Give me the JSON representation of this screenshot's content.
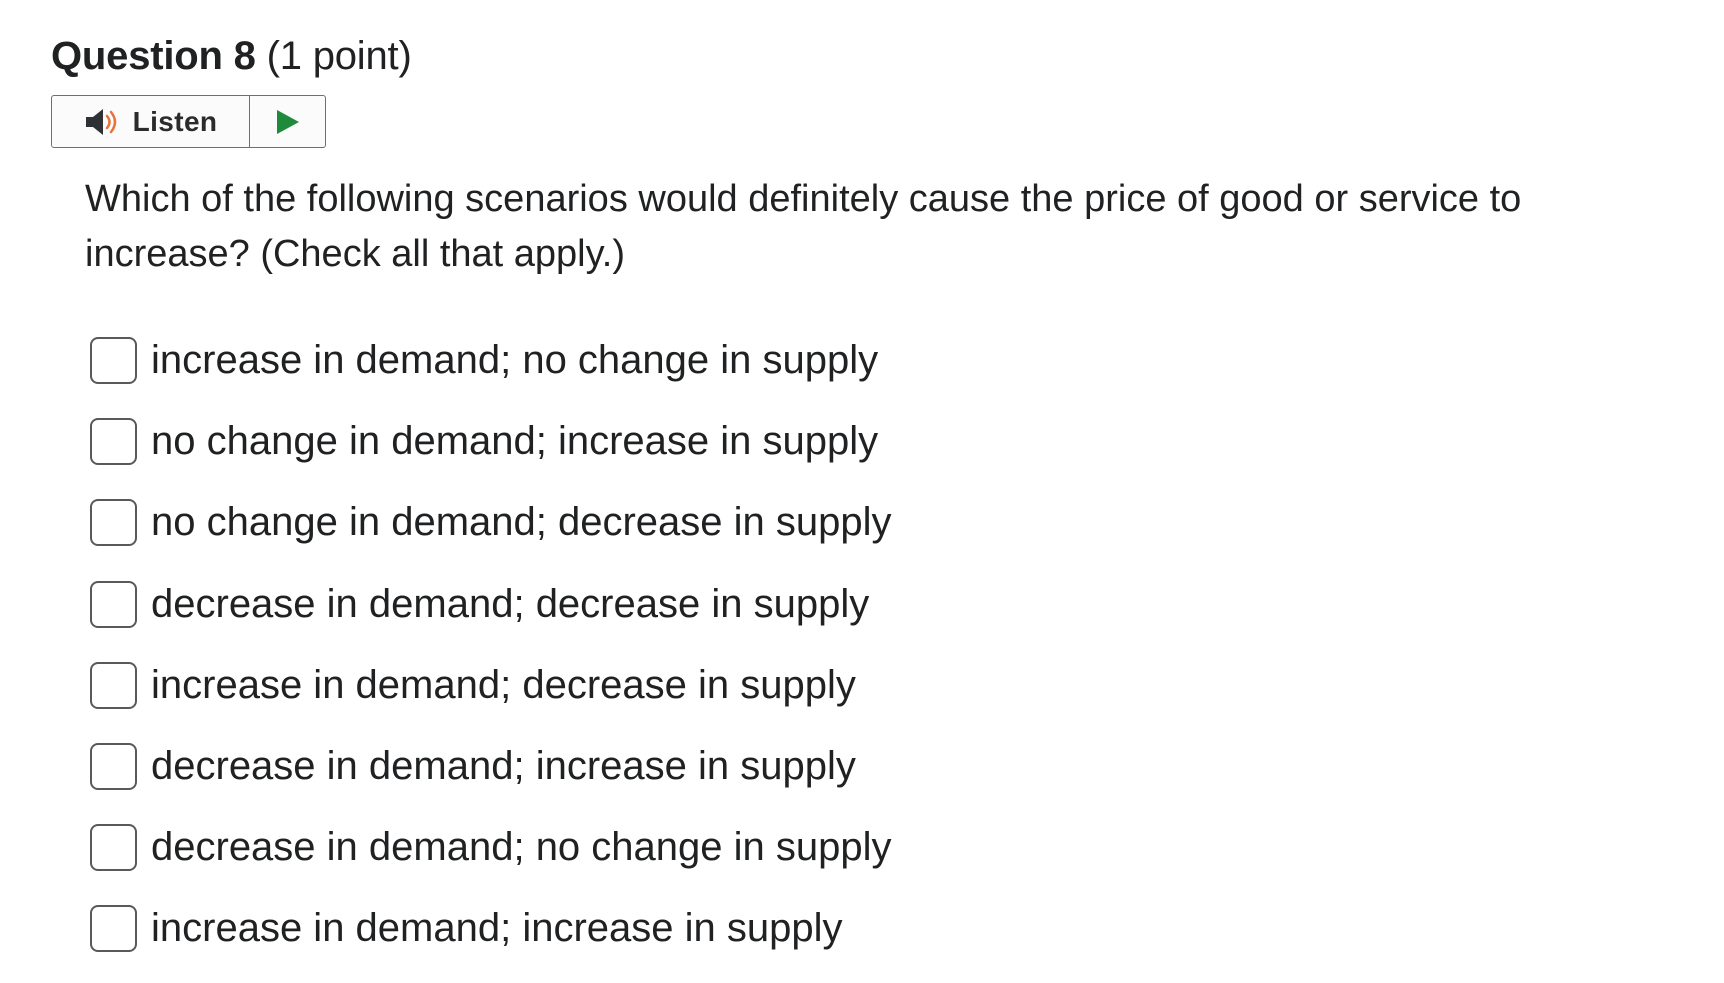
{
  "question": {
    "title": "Question 8",
    "points": "(1 point)"
  },
  "listen": {
    "label": "Listen",
    "speaker_icon": "speaker-icon",
    "play_icon": "play-icon",
    "speaker_accent": "#e8733a",
    "play_color": "#1f8a3b"
  },
  "prompt": "Which of the following scenarios would definitely cause the price of good or service to increase? (Check all that apply.)",
  "options": [
    {
      "label": "increase in demand; no change in supply",
      "checked": false
    },
    {
      "label": "no change in demand; increase in supply",
      "checked": false
    },
    {
      "label": "no change in demand; decrease in supply",
      "checked": false
    },
    {
      "label": "decrease in demand; decrease in supply",
      "checked": false
    },
    {
      "label": "increase in demand; decrease in supply",
      "checked": false
    },
    {
      "label": "decrease in demand; increase in supply",
      "checked": false
    },
    {
      "label": "decrease in demand; no change in supply",
      "checked": false
    },
    {
      "label": "increase in demand; increase in supply",
      "checked": false
    }
  ]
}
